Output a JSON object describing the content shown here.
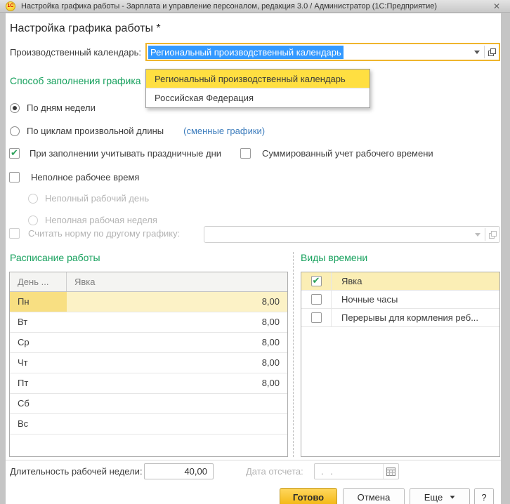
{
  "window": {
    "logo": "1С",
    "title": "Настройка графика работы - Зарплата и управление персоналом, редакция 3.0 / Администратор  (1С:Предприятие)",
    "close": "✕"
  },
  "page": {
    "title": "Настройка графика работы *"
  },
  "calendar_field": {
    "label": "Производственный календарь:",
    "value": "Региональный производственный календарь"
  },
  "dropdown": {
    "items": [
      {
        "label": "Региональный производственный календарь",
        "selected": true
      },
      {
        "label": "Российская Федерация",
        "selected": false
      }
    ]
  },
  "fill_method": {
    "heading": "Способ заполнения графика",
    "radio_by_days": "По дням недели",
    "radio_by_cycles": "По циклам произвольной длины",
    "cycles_link": "(сменные графики)",
    "check_holidays": "При заполнении учитывать праздничные дни",
    "check_summary": "Суммированный учет рабочего времени",
    "check_parttime": "Неполное рабочее время",
    "radio_part_day": "Неполный рабочий день",
    "radio_part_week": "Неполная рабочая неделя",
    "check_other_schedule": "Считать норму по другому графику:"
  },
  "schedule": {
    "heading": "Расписание работы",
    "columns": [
      "День ...",
      "Явка"
    ],
    "rows": [
      {
        "day": "Пн",
        "value": "8,00",
        "selected": true
      },
      {
        "day": "Вт",
        "value": "8,00",
        "selected": false
      },
      {
        "day": "Ср",
        "value": "8,00",
        "selected": false
      },
      {
        "day": "Чт",
        "value": "8,00",
        "selected": false
      },
      {
        "day": "Пт",
        "value": "8,00",
        "selected": false
      },
      {
        "day": "Сб",
        "value": "",
        "selected": false
      },
      {
        "day": "Вс",
        "value": "",
        "selected": false
      }
    ]
  },
  "time_kinds": {
    "heading": "Виды времени",
    "rows": [
      {
        "label": "Явка",
        "checked": true,
        "selected": true
      },
      {
        "label": "Ночные часы",
        "checked": false,
        "selected": false
      },
      {
        "label": "Перерывы для кормления реб...",
        "checked": false,
        "selected": false
      }
    ]
  },
  "footer": {
    "week_length_label": "Длительность рабочей недели:",
    "week_length_value": "40,00",
    "start_date_label": "Дата отсчета:",
    "start_date_placeholder": ". .",
    "buttons": {
      "done": "Готово",
      "cancel": "Отмена",
      "more": "Еще",
      "help": "?"
    }
  },
  "colors": {
    "green": "#15a05c",
    "link": "#3d7dbd",
    "sel-blue": "#3399ff",
    "focus": "#efb52d",
    "dd-yellow": "#ffdf41",
    "row-yellow": "#fbeeb5"
  }
}
